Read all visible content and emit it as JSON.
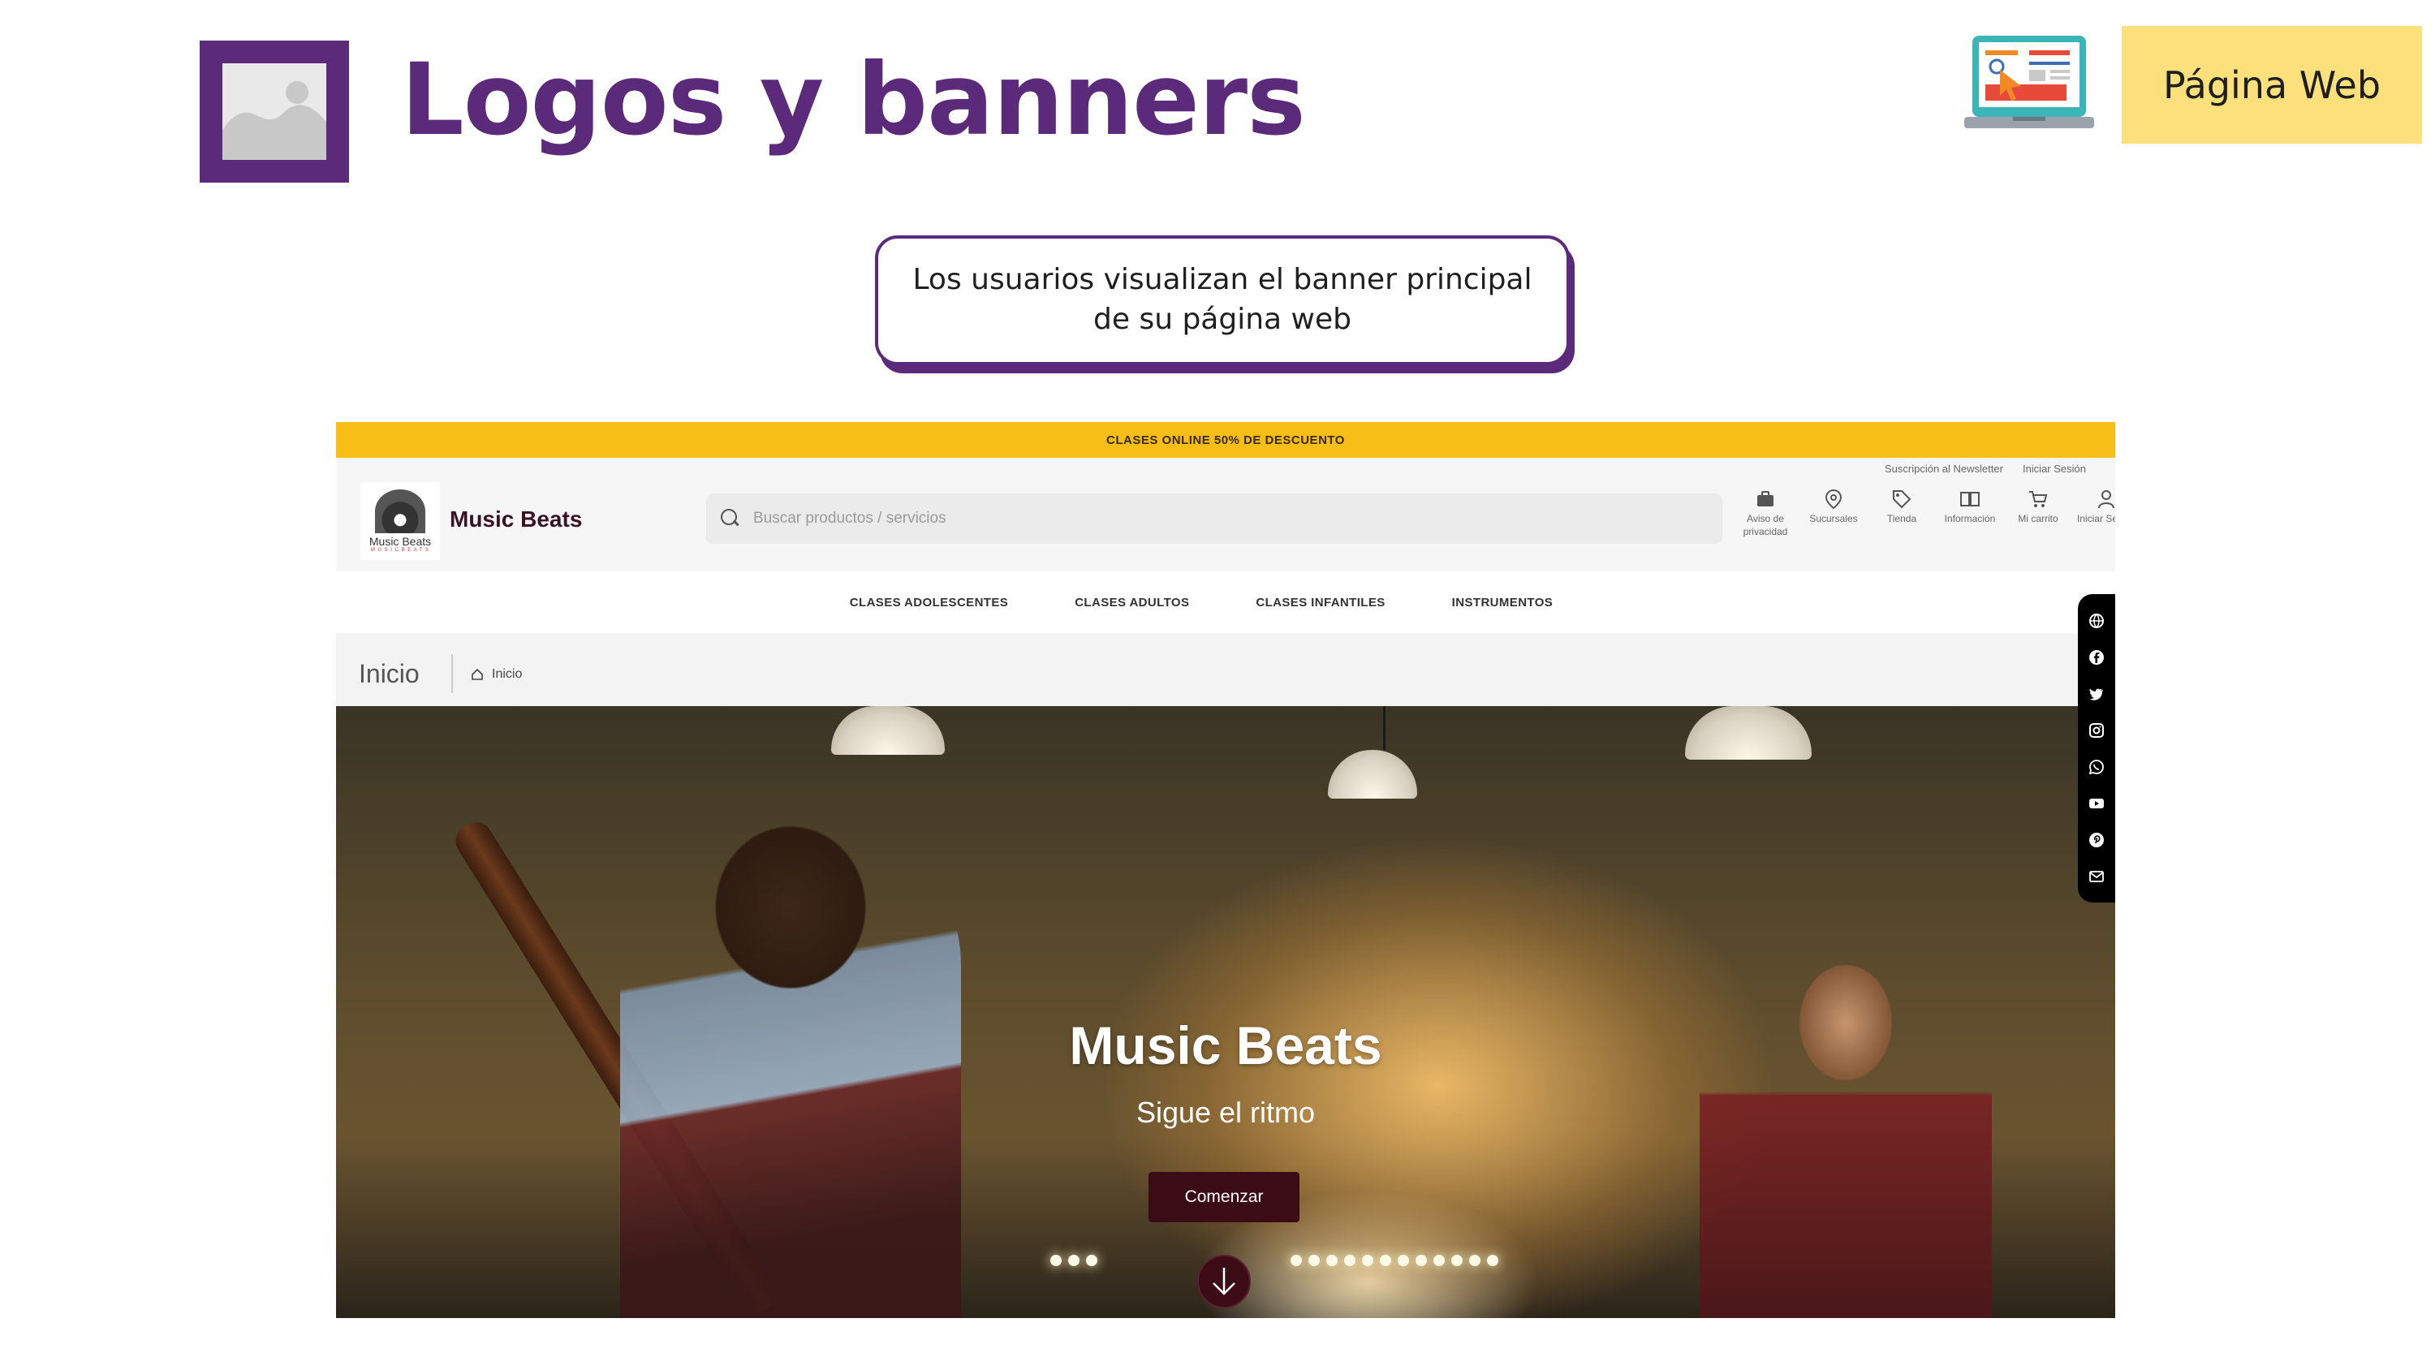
{
  "slide": {
    "title": "Logos y banners",
    "badge": "Página Web",
    "callout": "Los usuarios visualizan el  banner principal de su página web"
  },
  "site": {
    "promo_bar": "CLASES ONLINE 50% DE DESCUENTO",
    "top_links": [
      "Suscripción al Newsletter",
      "Iniciar Sesión"
    ],
    "logo": {
      "text": "Music Beats",
      "subtext": "M U S I C B E A T S"
    },
    "brand_name": "Music Beats",
    "search": {
      "placeholder": "Buscar productos / servicios",
      "value": ""
    },
    "header_actions": [
      {
        "label": "Aviso de privacidad",
        "icon": "briefcase-icon"
      },
      {
        "label": "Sucursales",
        "icon": "location-pin-icon"
      },
      {
        "label": "Tienda",
        "icon": "tag-icon"
      },
      {
        "label": "Información",
        "icon": "book-icon"
      },
      {
        "label": "Mi carrito",
        "icon": "cart-icon"
      },
      {
        "label": "Iniciar Sesión",
        "icon": "user-icon"
      }
    ],
    "nav": [
      "CLASES ADOLESCENTES",
      "CLASES ADULTOS",
      "CLASES INFANTILES",
      "INSTRUMENTOS"
    ],
    "breadcrumb": {
      "title": "Inicio",
      "home": "Inicio"
    },
    "hero": {
      "title": "Music Beats",
      "subtitle": "Sigue el ritmo",
      "button": "Comenzar"
    },
    "social": [
      "globe-icon",
      "facebook-icon",
      "twitter-icon",
      "instagram-icon",
      "whatsapp-icon",
      "youtube-icon",
      "pinterest-icon",
      "mail-icon"
    ]
  },
  "colors": {
    "accent": "#5c2a7a",
    "badge": "#fbe07c",
    "promo": "#f6be16",
    "hero_button": "#3c0c16"
  }
}
